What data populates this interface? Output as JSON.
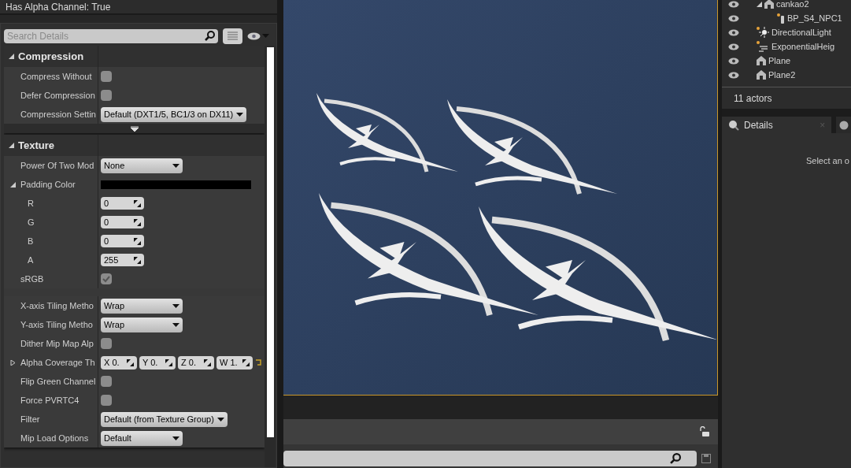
{
  "details": {
    "header": "Has Alpha Channel: True",
    "search": {
      "placeholder": "Search Details"
    },
    "sections": [
      {
        "label": "Compression",
        "expanded": true,
        "rows": [
          {
            "kind": "checkbox",
            "label": "Compress Without",
            "checked": false
          },
          {
            "kind": "checkbox",
            "label": "Defer Compression",
            "checked": false
          },
          {
            "kind": "dropdown",
            "label": "Compression Settin",
            "value": "Default (DXT1/5, BC1/3 on DX11)"
          }
        ]
      },
      {
        "label": "Texture",
        "expanded": true,
        "rows": [
          {
            "kind": "dropdown",
            "label": "Power Of Two Mod",
            "value": "None"
          },
          {
            "kind": "color",
            "label": "Padding Color",
            "expanded": true,
            "color": "#000000",
            "children": [
              {
                "kind": "number",
                "label": "R",
                "value": "0"
              },
              {
                "kind": "number",
                "label": "G",
                "value": "0"
              },
              {
                "kind": "number",
                "label": "B",
                "value": "0"
              },
              {
                "kind": "number",
                "label": "A",
                "value": "255"
              }
            ]
          },
          {
            "kind": "checkbox",
            "label": "sRGB",
            "checked": true
          }
        ],
        "advanced_rows": [
          {
            "kind": "dropdown",
            "label": "X-axis Tiling Metho",
            "value": "Wrap"
          },
          {
            "kind": "dropdown",
            "label": "Y-axis Tiling Metho",
            "value": "Wrap"
          },
          {
            "kind": "checkbox",
            "label": "Dither Mip Map Alp",
            "checked": false
          },
          {
            "kind": "vector",
            "label": "Alpha Coverage Th",
            "expanded": false,
            "components": [
              {
                "axis": "X",
                "value": "0."
              },
              {
                "axis": "Y",
                "value": "0."
              },
              {
                "axis": "Z",
                "value": "0."
              },
              {
                "axis": "W",
                "value": "1."
              }
            ]
          },
          {
            "kind": "checkbox",
            "label": "Flip Green Channel",
            "checked": false
          },
          {
            "kind": "checkbox",
            "label": "Force PVRTC4",
            "checked": false
          },
          {
            "kind": "dropdown",
            "label": "Filter",
            "value": "Default (from Texture Group)"
          },
          {
            "kind": "dropdown",
            "label": "Mip Load Options",
            "value": "Default"
          }
        ]
      }
    ]
  },
  "outliner": {
    "items": [
      {
        "kind": "actor",
        "label": "cankao2",
        "visible": true,
        "expanded": true,
        "children": [
          {
            "kind": "blueprint",
            "label": "BP_S4_NPC1",
            "visible": true
          }
        ]
      },
      {
        "kind": "light",
        "label": "DirectionalLight",
        "visible": true
      },
      {
        "kind": "fog",
        "label": "ExponentialHeig",
        "visible": true
      },
      {
        "kind": "mesh",
        "label": "Plane",
        "visible": true
      },
      {
        "kind": "mesh",
        "label": "Plane2",
        "visible": true
      }
    ],
    "count": "11 actors"
  },
  "details_tab": {
    "label": "Details",
    "close": "×",
    "selected": true,
    "message": "Select an o"
  }
}
